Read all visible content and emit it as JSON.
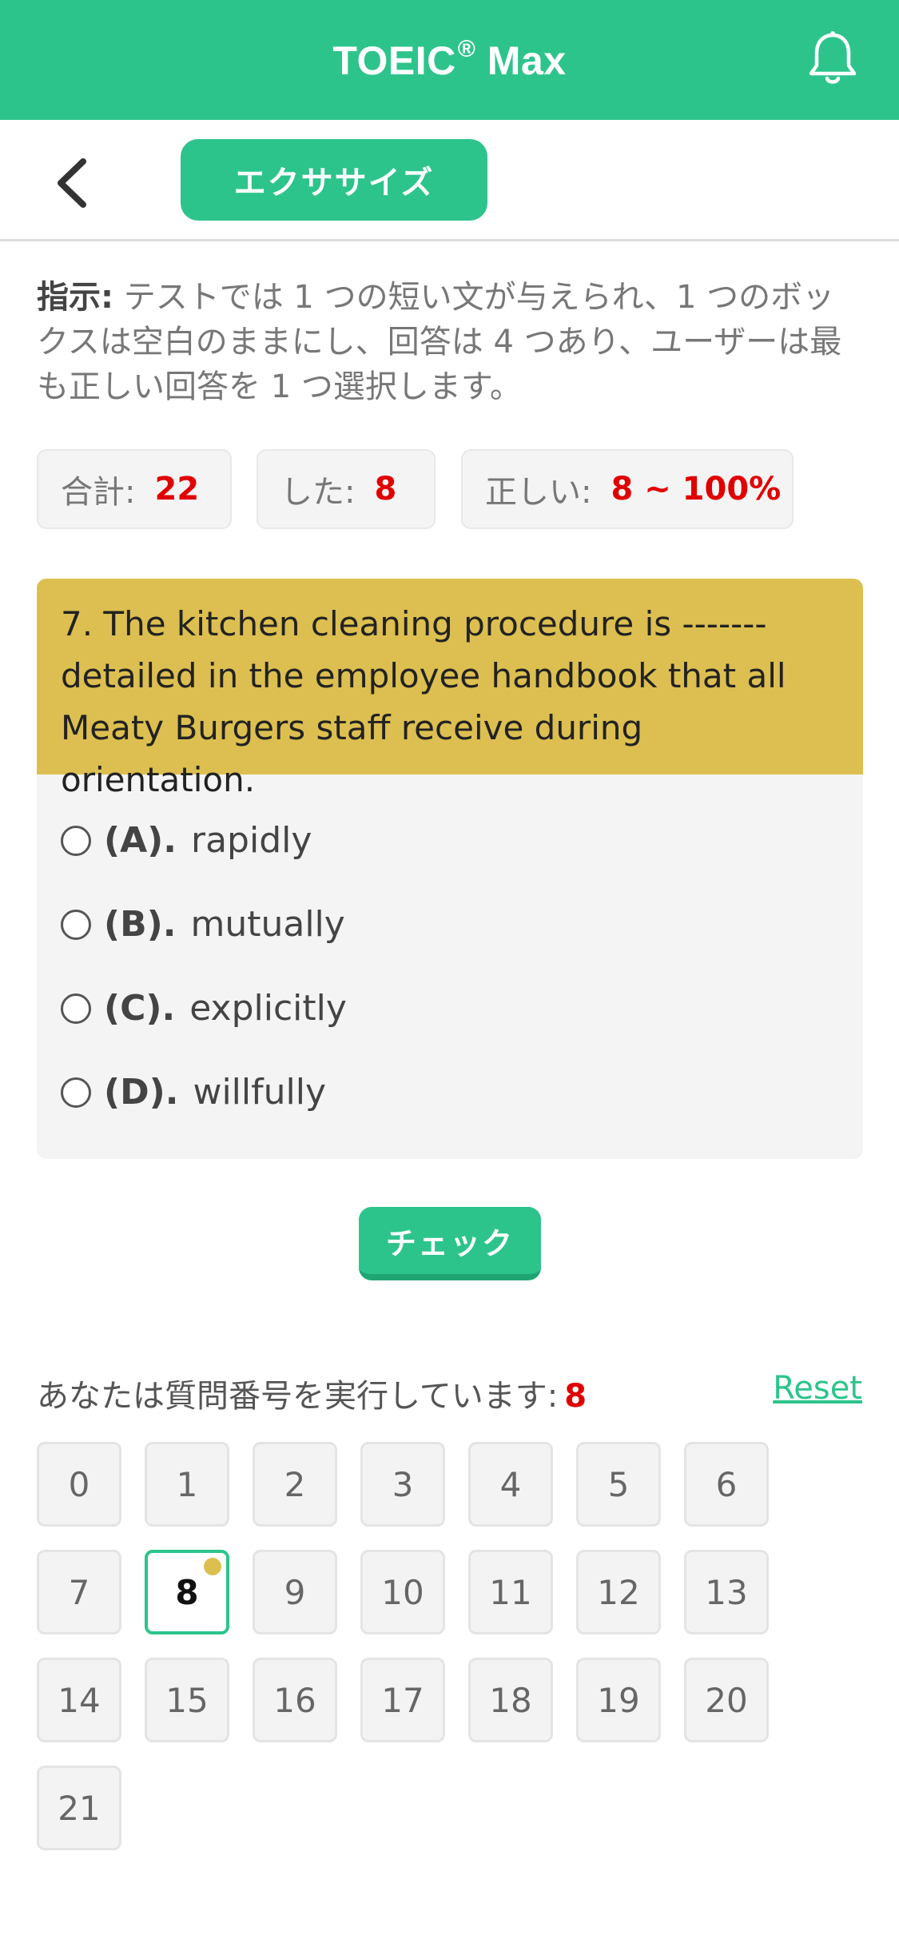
{
  "header": {
    "title": "TOEIC",
    "title_mark": "®",
    "title_suffix": " Max",
    "bell_icon": "bell-icon",
    "color": "#2dc48b"
  },
  "subheader": {
    "back_icon": "chevron-left-icon",
    "exercise_label": "エクササイズ"
  },
  "instructions": {
    "label": "指示:",
    "text": " テストでは 1 つの短い文が与えられ、1 つのボックスは空白のままにし、回答は 4 つあり、ユーザーは最も正しい回答を 1 つ選択します。"
  },
  "stats": {
    "total_label": "合計:",
    "total_value": "22",
    "done_label": "した:",
    "done_value": "8",
    "correct_label": "正しい:",
    "correct_value": "8 ~ 100%"
  },
  "question": {
    "text": "7. The kitchen cleaning procedure is ------- detailed in the employee handbook that all Meaty Burgers staff receive during orientation.",
    "options": [
      {
        "letter": "(A).",
        "text": "rapidly"
      },
      {
        "letter": "(B).",
        "text": "mutually"
      },
      {
        "letter": "(C).",
        "text": "explicitly"
      },
      {
        "letter": "(D).",
        "text": "willfully"
      }
    ]
  },
  "check_label": "チェック",
  "progress": {
    "label": "あなたは質問番号を実行しています:",
    "current": "8",
    "reset_label": "Reset",
    "numbers": [
      "0",
      "1",
      "2",
      "3",
      "4",
      "5",
      "6",
      "7",
      "8",
      "9",
      "10",
      "11",
      "12",
      "13",
      "14",
      "15",
      "16",
      "17",
      "18",
      "19",
      "20",
      "21"
    ]
  },
  "colors": {
    "accent": "#2dc48b",
    "question_bg": "#dcbf50",
    "highlight_red": "#e00000"
  }
}
